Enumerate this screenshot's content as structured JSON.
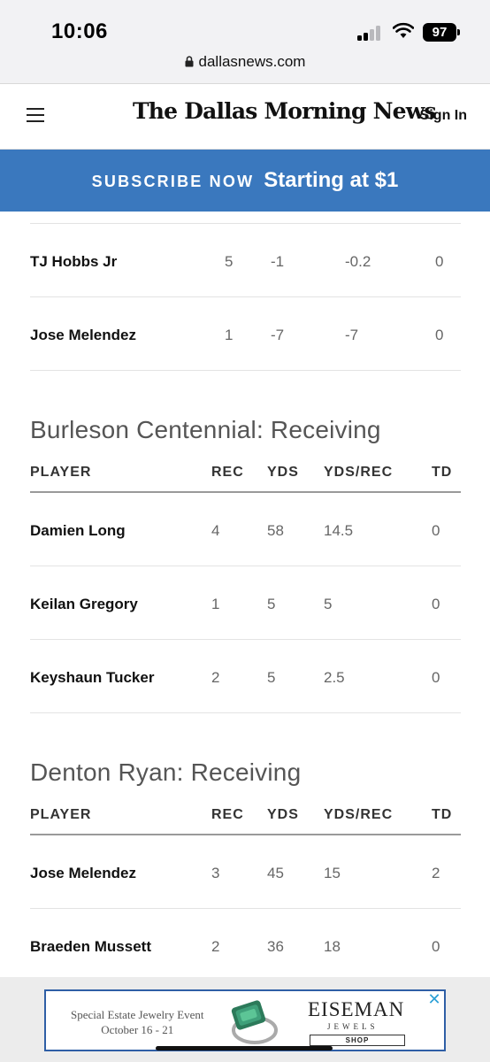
{
  "status_bar": {
    "time": "10:06",
    "battery": "97"
  },
  "browser": {
    "url": "dallasnews.com"
  },
  "header": {
    "logo": "The Dallas Morning News",
    "sign_in": "Sign In"
  },
  "subscribe": {
    "small": "SUBSCRIBE NOW",
    "big": "Starting at $1"
  },
  "rushing_tail": {
    "rows": [
      {
        "player": "TJ Hobbs Jr",
        "c1": "5",
        "c2": "-1",
        "c3": "-0.2",
        "c4": "0"
      },
      {
        "player": "Jose Melendez",
        "c1": "1",
        "c2": "-7",
        "c3": "-7",
        "c4": "0"
      }
    ]
  },
  "sections": [
    {
      "title": "Burleson Centennial: Receiving",
      "columns": [
        "PLAYER",
        "REC",
        "YDS",
        "YDS/REC",
        "TD"
      ],
      "rows": [
        {
          "player": "Damien Long",
          "rec": "4",
          "yds": "58",
          "avg": "14.5",
          "td": "0"
        },
        {
          "player": "Keilan Gregory",
          "rec": "1",
          "yds": "5",
          "avg": "5",
          "td": "0"
        },
        {
          "player": "Keyshaun Tucker",
          "rec": "2",
          "yds": "5",
          "avg": "2.5",
          "td": "0"
        }
      ]
    },
    {
      "title": "Denton Ryan: Receiving",
      "columns": [
        "PLAYER",
        "REC",
        "YDS",
        "YDS/REC",
        "TD"
      ],
      "rows": [
        {
          "player": "Jose Melendez",
          "rec": "3",
          "yds": "45",
          "avg": "15",
          "td": "2"
        },
        {
          "player": "Braeden Mussett",
          "rec": "2",
          "yds": "36",
          "avg": "18",
          "td": "0"
        }
      ]
    }
  ],
  "ad": {
    "line1": "Special Estate Jewelry Event",
    "line2": "October 16 - 21",
    "brand": "EISEMAN",
    "brand_sub": "JEWELS",
    "cta": "SHOP",
    "accent": "#2f5fa6"
  },
  "colors": {
    "subscribe_bg": "#3a78be",
    "close_icon": "#2a9fd6"
  }
}
